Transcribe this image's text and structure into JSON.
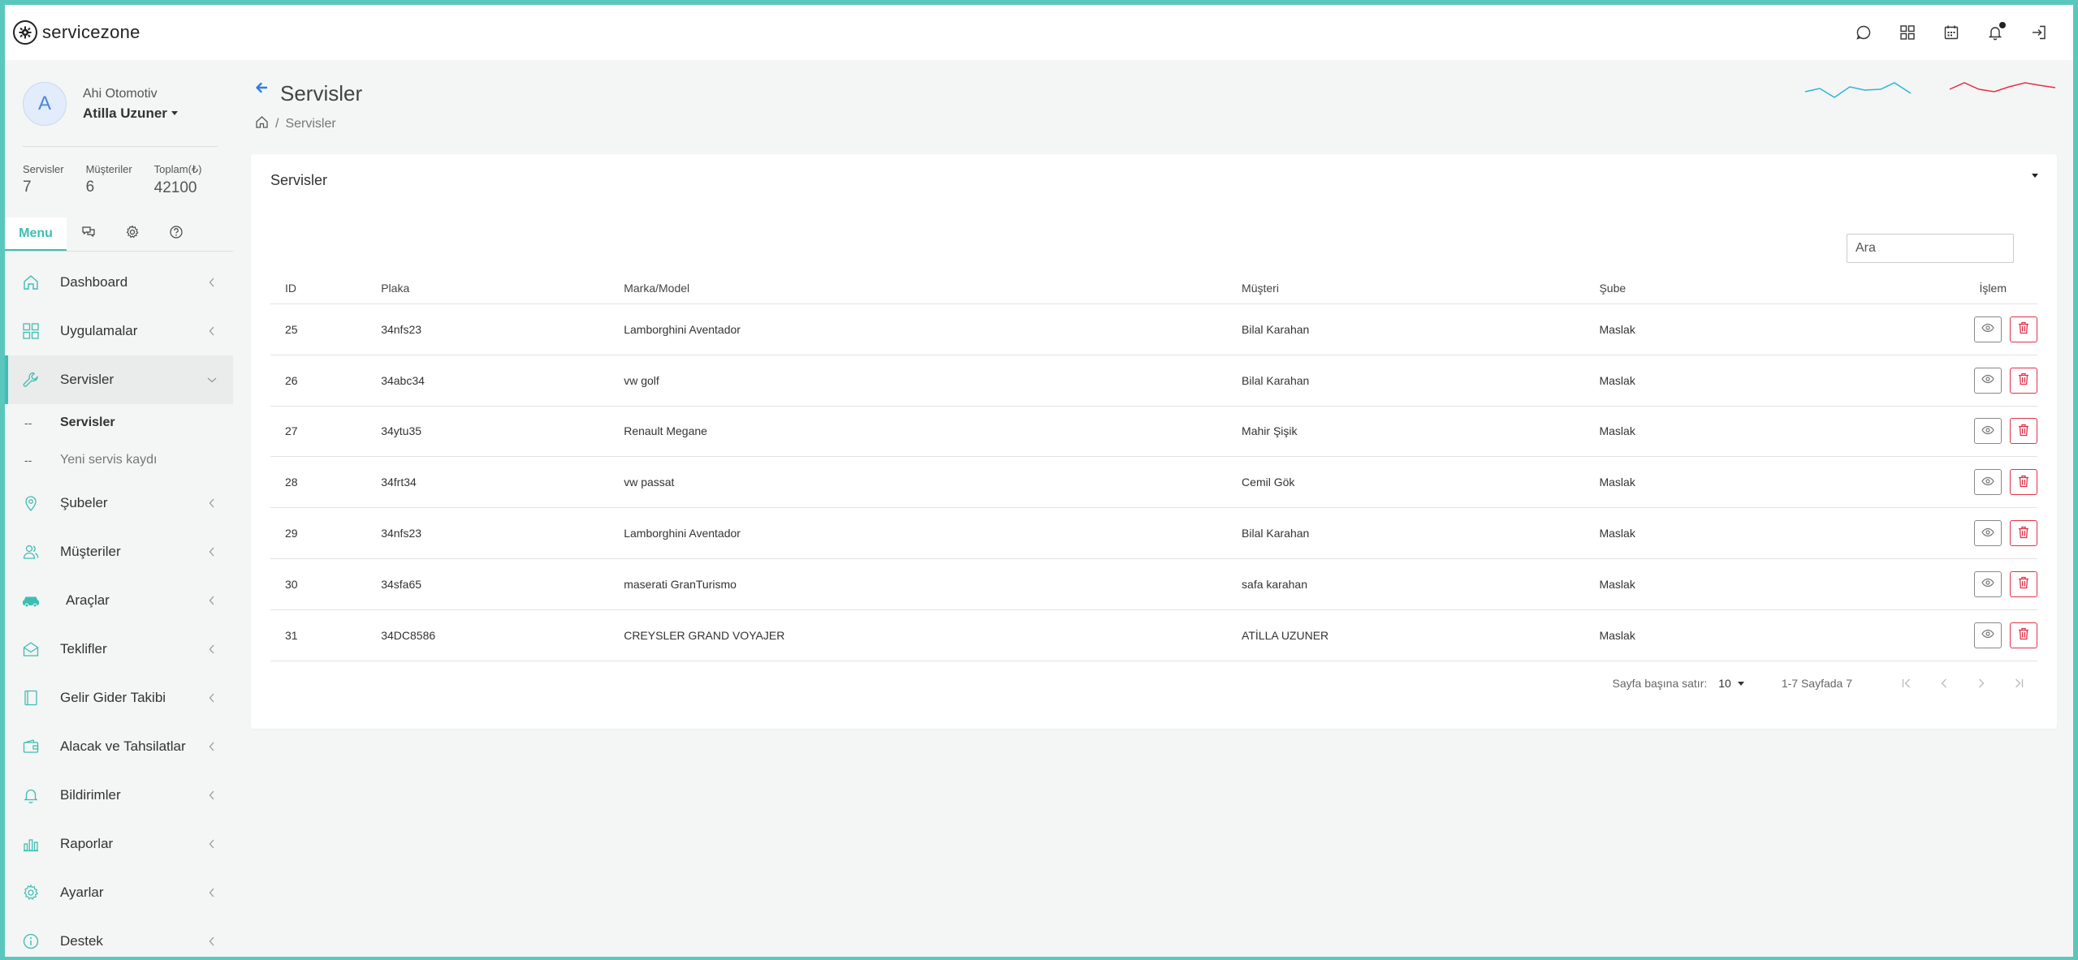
{
  "brand": {
    "name": "servicezone"
  },
  "profile": {
    "initial": "A",
    "company": "Ahi Otomotiv",
    "user": "Atilla Uzuner"
  },
  "stats": [
    {
      "label": "Servisler",
      "value": "7"
    },
    {
      "label": "Müşteriler",
      "value": "6"
    },
    {
      "label": "Toplam(₺)",
      "value": "42100"
    }
  ],
  "sidebar_tabs": {
    "menu": "Menu"
  },
  "nav": {
    "dashboard": "Dashboard",
    "apps": "Uygulamalar",
    "services": "Servisler",
    "services_sub": [
      "Servisler",
      "Yeni servis kaydı"
    ],
    "branches": "Şubeler",
    "customers": "Müşteriler",
    "vehicles": "Araçlar",
    "offers": "Teklifler",
    "income": "Gelir Gider Takibi",
    "receivables": "Alacak ve Tahsilatlar",
    "notifications": "Bildirimler",
    "reports": "Raporlar",
    "settings": "Ayarlar",
    "support": "Destek"
  },
  "page": {
    "title": "Servisler",
    "breadcrumb": "Servisler"
  },
  "card": {
    "title": "Servisler",
    "search_placeholder": "Ara"
  },
  "table": {
    "columns": [
      "ID",
      "Plaka",
      "Marka/Model",
      "Müşteri",
      "Şube",
      "İşlem"
    ],
    "rows": [
      [
        "25",
        "34nfs23",
        "Lamborghini Aventador",
        "Bilal Karahan",
        "Maslak"
      ],
      [
        "26",
        "34abc34",
        "vw golf",
        "Bilal Karahan",
        "Maslak"
      ],
      [
        "27",
        "34ytu35",
        "Renault Megane",
        "Mahir Şişik",
        "Maslak"
      ],
      [
        "28",
        "34frt34",
        "vw passat",
        "Cemil Gök",
        "Maslak"
      ],
      [
        "29",
        "34nfs23",
        "Lamborghini Aventador",
        "Bilal Karahan",
        "Maslak"
      ],
      [
        "30",
        "34sfa65",
        "maserati GranTurismo",
        "safa karahan",
        "Maslak"
      ],
      [
        "31",
        "34DC8586",
        "CREYSLER GRAND VOYAJER",
        "ATİLLA UZUNER",
        "Maslak"
      ]
    ]
  },
  "pager": {
    "rows_label": "Sayfa başına satır:",
    "rows_value": "10",
    "info": "1-7 Sayfada 7"
  },
  "colors": {
    "accent": "#3dbeb3",
    "danger": "#e2314a",
    "spark_blue": "#29b6d6",
    "spark_red": "#e2314a"
  }
}
